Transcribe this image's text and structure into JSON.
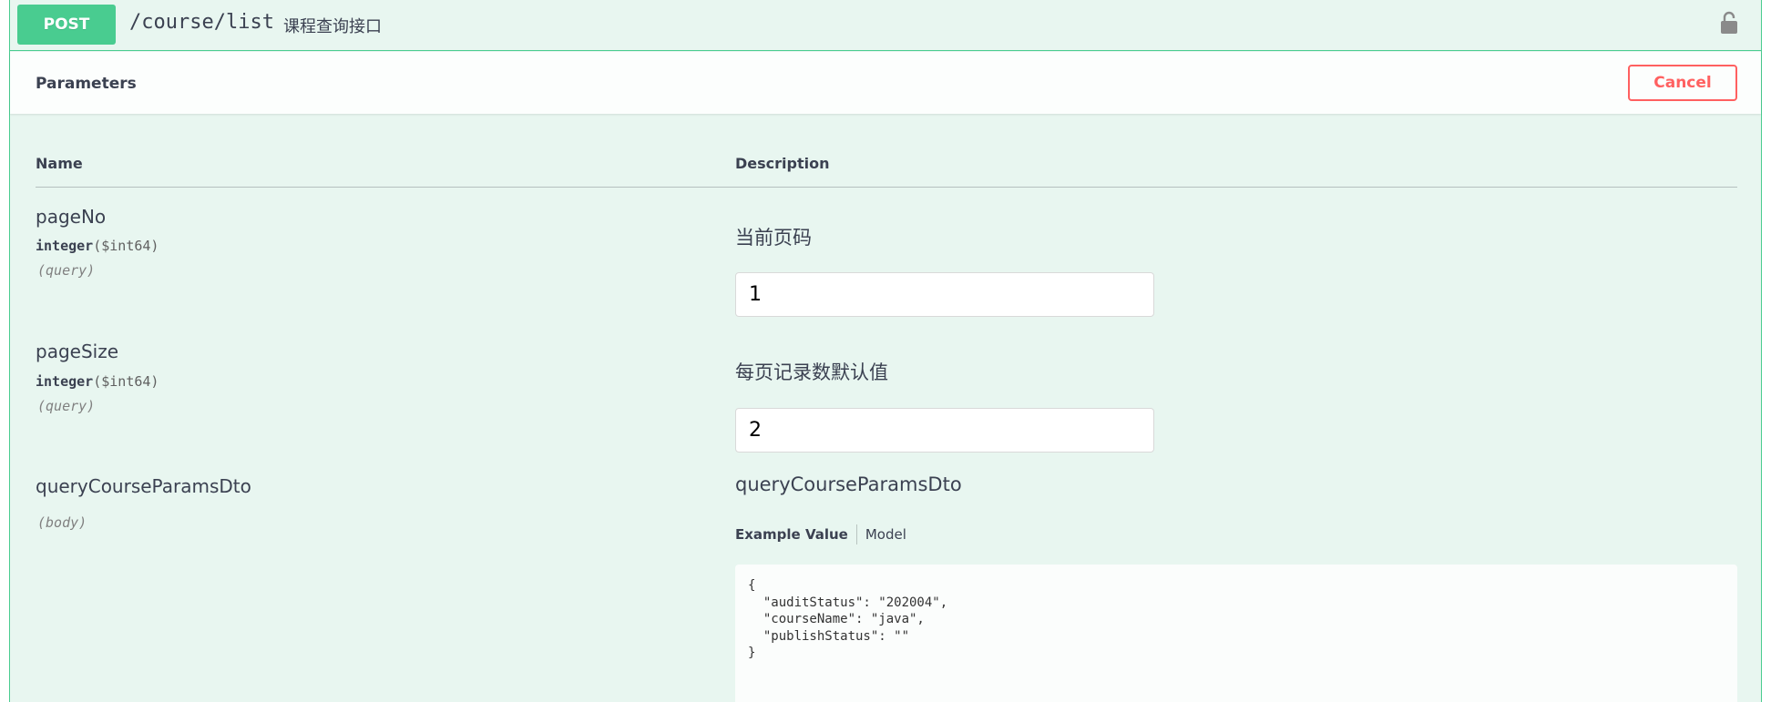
{
  "summary": {
    "method": "POST",
    "path": "/course/list",
    "description": "课程查询接口",
    "lock_icon": "lock-icon"
  },
  "section": {
    "title": "Parameters",
    "cancel_label": "Cancel"
  },
  "columns": {
    "name": "Name",
    "description": "Description"
  },
  "parameters": [
    {
      "name": "pageNo",
      "type": "integer",
      "format": "($int64)",
      "in": "(query)",
      "description": "当前页码",
      "value": "1"
    },
    {
      "name": "pageSize",
      "type": "integer",
      "format": "($int64)",
      "in": "(query)",
      "description": "每页记录数默认值",
      "value": "2"
    },
    {
      "name": "queryCourseParamsDto",
      "in": "(body)",
      "description": "queryCourseParamsDto"
    }
  ],
  "body_tabs": {
    "example": "Example Value",
    "model": "Model"
  },
  "example_value": "{\n  \"auditStatus\": \"202004\",\n  \"courseName\": \"java\",\n  \"publishStatus\": \"\"\n}",
  "colors": {
    "post_green": "#49cc90",
    "block_bg": "#e8f6f0",
    "cancel_red": "#ff6060",
    "text": "#3b4151"
  }
}
